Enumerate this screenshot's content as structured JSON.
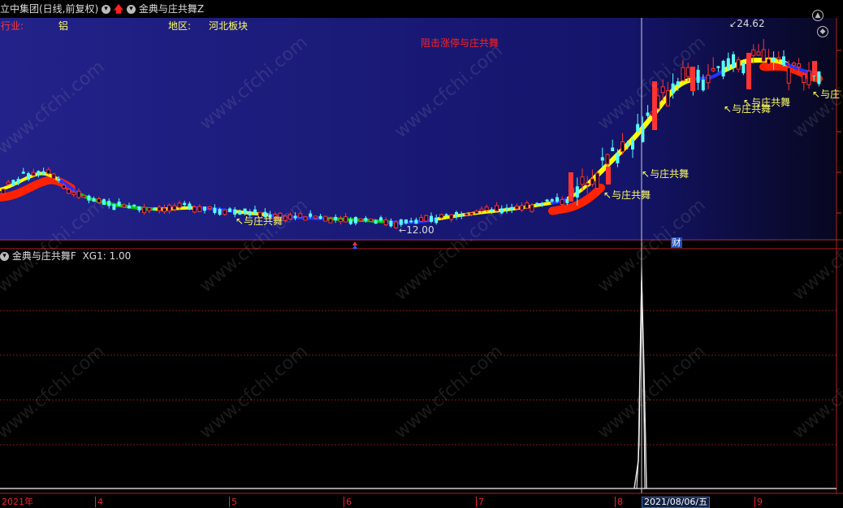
{
  "header": {
    "stock_title": "立中集团(日线,前复权)",
    "indicator_name": "金典与庄共舞Z",
    "industry_label": "行业:",
    "industry_value": "铝",
    "region_label": "地区:",
    "region_value": "河北板块",
    "signal_text": "阻击涨停与庄共舞"
  },
  "annotations": {
    "signal_label": "与庄共舞",
    "signal_label_truncated": "与庄",
    "high_price": "24.62",
    "low_price": "12.00",
    "finance_mark": "财"
  },
  "indicator_panel": {
    "title": "金典与庄共舞F",
    "value_text": "XG1: 1.00"
  },
  "time_axis": {
    "labels": [
      "2021年",
      "4",
      "5",
      "6",
      "7",
      "8",
      "9"
    ],
    "cursor_date": "2021/08/06/五"
  },
  "colors": {
    "up_candle": "#ff3333",
    "down_candle": "#55ffff",
    "yellow_line": "#ffff00",
    "red_band": "#ff2200",
    "green_line": "#00cc00",
    "blue_line": "#2233ff",
    "signal_text": "#ff2020",
    "label_yellow": "#ffff66"
  }
}
